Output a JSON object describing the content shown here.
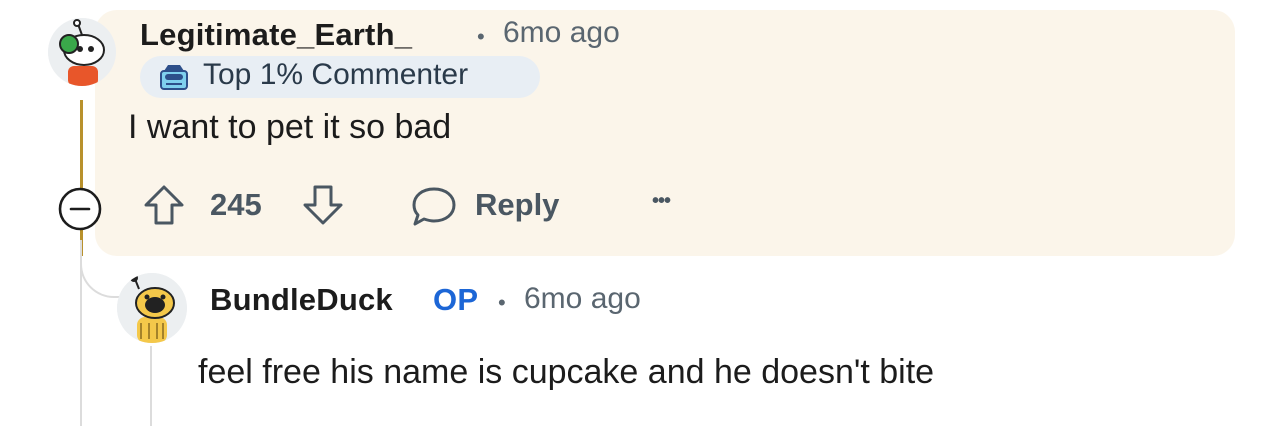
{
  "parent_comment": {
    "username": "Legitimate_Earth_",
    "separator": "•",
    "timestamp": "6mo ago",
    "badge_label": "Top 1% Commenter",
    "body": "I want to pet it so bad",
    "score": "245",
    "reply_label": "Reply",
    "more_label": "•••"
  },
  "reply_comment": {
    "username": "BundleDuck",
    "op_label": "OP",
    "separator": "•",
    "timestamp": "6mo ago",
    "body": "feel free his name is cupcake and he doesn't bite"
  },
  "colors": {
    "highlight_bg": "#fbf5ea",
    "thread_accent": "#b8912c",
    "op_blue": "#1c66d6",
    "muted_text": "#5a6670"
  }
}
